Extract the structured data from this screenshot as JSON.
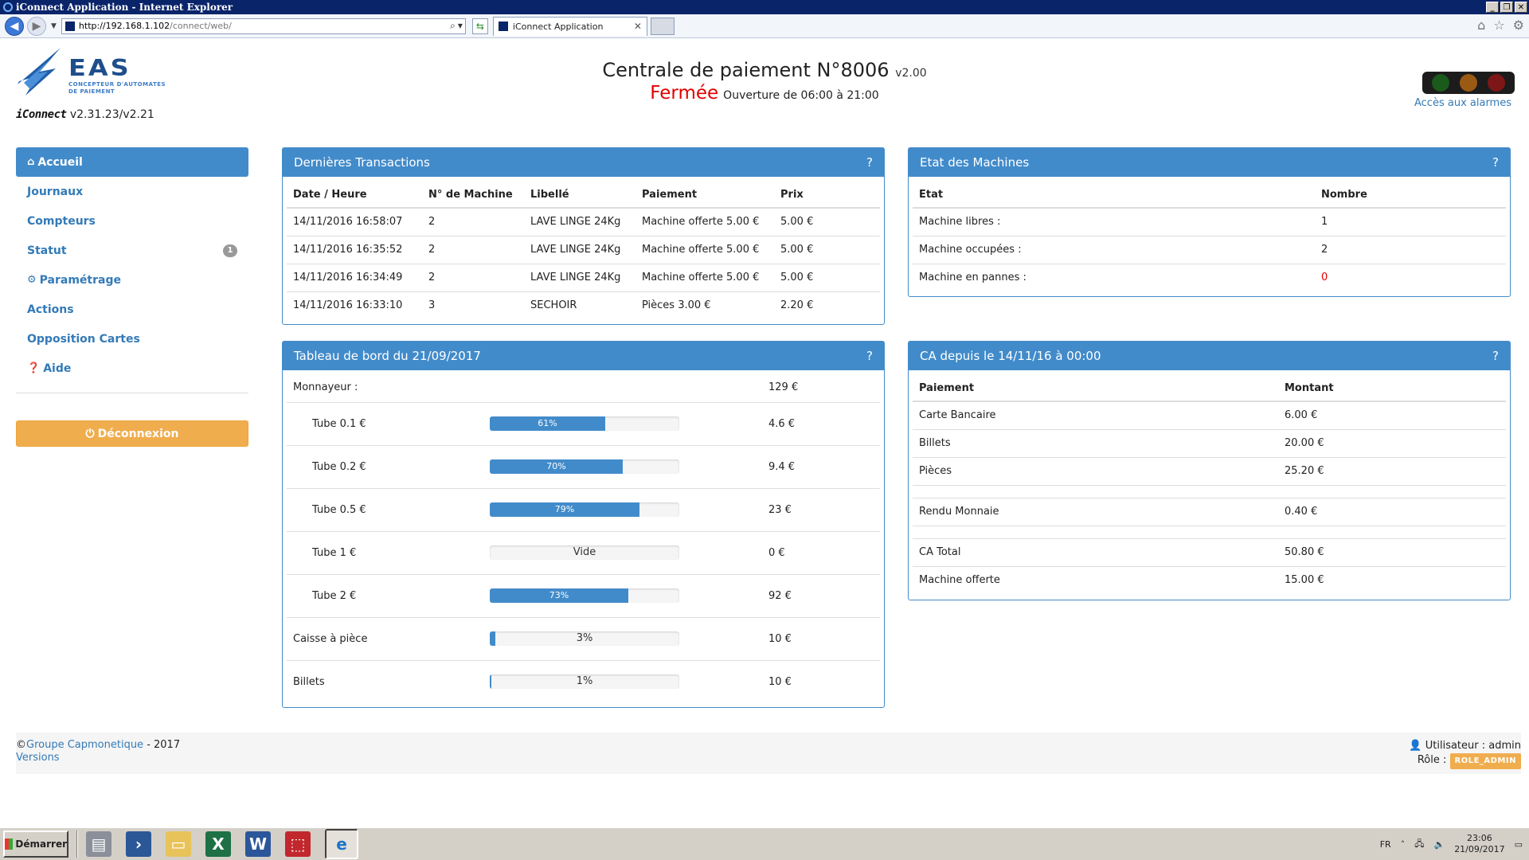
{
  "browser": {
    "window_title": "iConnect Application - Internet Explorer",
    "url_host": "http://192.168.1.102",
    "url_path": "/connect/web/",
    "tab_title": "iConnect Application"
  },
  "header": {
    "logo_text": "EAS",
    "logo_sub_1": "CONCEPTEUR D'AUTOMATES",
    "logo_sub_2": "DE PAIEMENT",
    "brand": "iConnect",
    "version": "v2.31.23/v2.21",
    "title": "Centrale de paiement N°8006",
    "title_version": "v2.00",
    "status": "Fermée",
    "hours": "Ouverture de 06:00 à 21:00",
    "alarm_link": "Accès aux alarmes"
  },
  "sidebar": {
    "items": [
      {
        "label": "Accueil",
        "icon": "home-icon"
      },
      {
        "label": "Journaux"
      },
      {
        "label": "Compteurs"
      },
      {
        "label": "Statut",
        "badge": "1"
      },
      {
        "label": "Paramétrage",
        "icon": "gear-icon"
      },
      {
        "label": "Actions"
      },
      {
        "label": "Opposition Cartes"
      },
      {
        "label": "Aide",
        "icon": "question-circle-icon"
      }
    ],
    "logout": "Déconnexion"
  },
  "transactions": {
    "title": "Dernières Transactions",
    "help": "?",
    "columns": [
      "Date / Heure",
      "N° de Machine",
      "Libellé",
      "Paiement",
      "Prix"
    ],
    "rows": [
      [
        "14/11/2016 16:58:07",
        "2",
        "LAVE LINGE 24Kg",
        "Machine offerte 5.00 €",
        "5.00 €"
      ],
      [
        "14/11/2016 16:35:52",
        "2",
        "LAVE LINGE 24Kg",
        "Machine offerte 5.00 €",
        "5.00 €"
      ],
      [
        "14/11/2016 16:34:49",
        "2",
        "LAVE LINGE 24Kg",
        "Machine offerte 5.00 €",
        "5.00 €"
      ],
      [
        "14/11/2016 16:33:10",
        "3",
        "SECHOIR",
        "Pièces 3.00 €",
        "2.20 €"
      ]
    ]
  },
  "machines": {
    "title": "Etat des Machines",
    "help": "?",
    "columns": [
      "Etat",
      "Nombre"
    ],
    "rows": [
      [
        "Machine libres :",
        "1"
      ],
      [
        "Machine occupées :",
        "2"
      ],
      [
        "Machine en pannes :",
        "0"
      ]
    ]
  },
  "dashboard": {
    "title": "Tableau de bord du 21/09/2017",
    "help": "?",
    "monnayeur_label": "Monnayeur :",
    "monnayeur_value": "129 €",
    "rows": [
      {
        "label": "Tube 0.1 €",
        "percent": 61,
        "bar_label": "61%",
        "value": "4.6 €"
      },
      {
        "label": "Tube 0.2 €",
        "percent": 70,
        "bar_label": "70%",
        "value": "9.4 €"
      },
      {
        "label": "Tube 0.5 €",
        "percent": 79,
        "bar_label": "79%",
        "value": "23 €"
      },
      {
        "label": "Tube 1 €",
        "percent": 0,
        "bar_label": "Vide",
        "value": "0 €"
      },
      {
        "label": "Tube 2 €",
        "percent": 73,
        "bar_label": "73%",
        "value": "92 €"
      },
      {
        "label": "Caisse à pièce",
        "percent": 3,
        "bar_label": "3%",
        "value": "10 €"
      },
      {
        "label": "Billets",
        "percent": 1,
        "bar_label": "1%",
        "value": "10 €"
      }
    ]
  },
  "ca": {
    "title": "CA depuis le 14/11/16 à 00:00",
    "help": "?",
    "columns": [
      "Paiement",
      "Montant"
    ],
    "rows": [
      [
        "Carte Bancaire",
        "6.00 €"
      ],
      [
        "Billets",
        "20.00 €"
      ],
      [
        "Pièces",
        "25.20 €"
      ],
      [
        "Rendu Monnaie",
        "0.40 €"
      ],
      [
        "CA Total",
        "50.80 €"
      ],
      [
        "Machine offerte",
        "15.00 €"
      ]
    ]
  },
  "footer": {
    "copyright": "©",
    "company": "Groupe Capmonetique",
    "year": " - 2017",
    "versions": "Versions",
    "user_label": "Utilisateur : admin",
    "role_label": "Rôle :",
    "role": "ROLE_ADMIN"
  },
  "taskbar": {
    "start": "Démarrer",
    "lang": "FR",
    "time": "23:06",
    "date": "21/09/2017"
  },
  "colors": {
    "primary": "#428bca",
    "warning": "#f0ad4e",
    "danger": "#e10000"
  }
}
